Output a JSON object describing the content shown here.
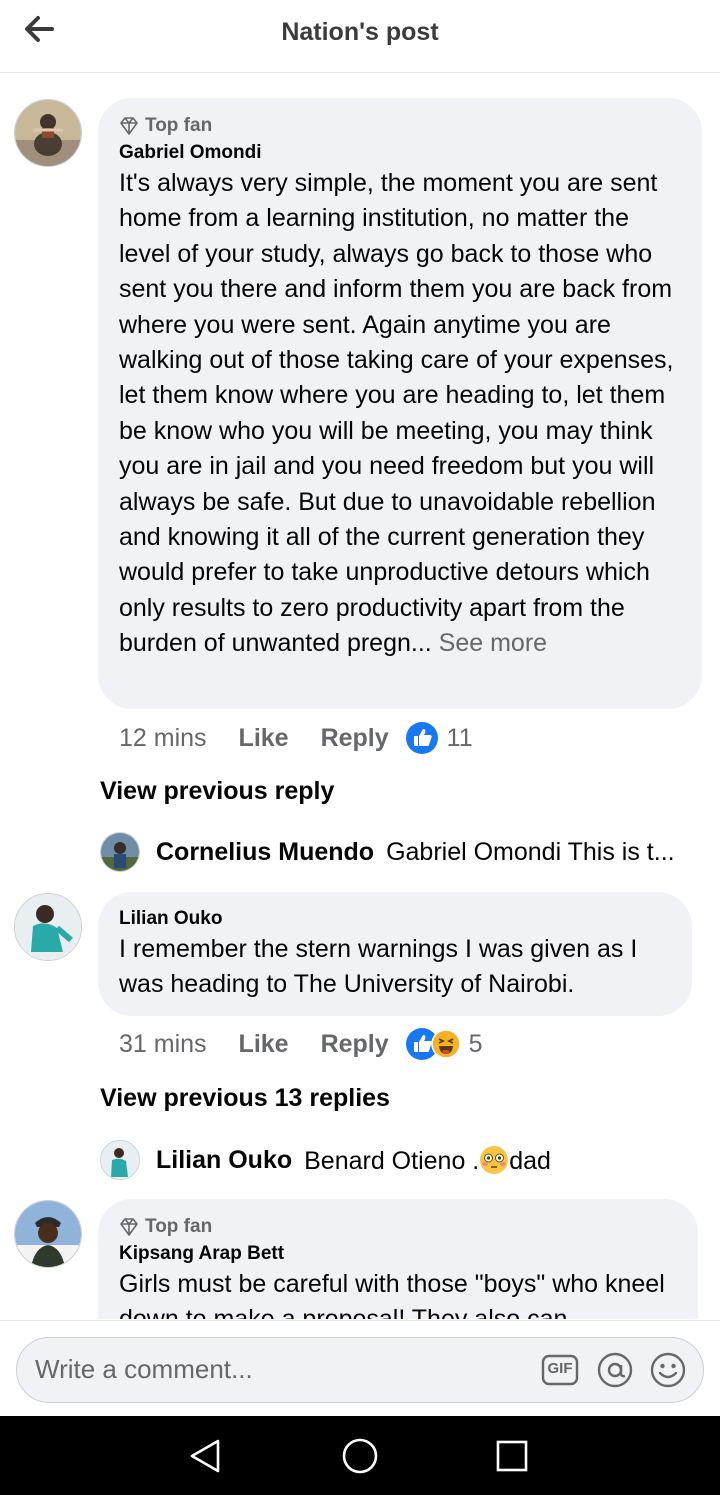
{
  "header": {
    "title": "Nation's post"
  },
  "comments": [
    {
      "badge": "Top fan",
      "name": "Gabriel Omondi",
      "text": "It's always very simple, the moment you are sent home from a learning institution, no matter the level of your study, always go back to those who sent you there and inform them you are back from where you were sent. Again anytime you are walking out of those taking care of your expenses, let them know where you are heading to, let them  be know who you will be meeting, you may think you are in jail and you need freedom but you will always be safe. But due to unavoidable rebellion and knowing it all of the current generation they would prefer to take unproductive detours which only results to zero productivity apart from the burden of unwanted pregn...",
      "see_more": " See more",
      "time": "12 mins",
      "like": "Like",
      "reply": "Reply",
      "reaction_count": "11",
      "view_previous": "View previous reply",
      "reply_preview": {
        "name": "Cornelius Muendo",
        "text": "Gabriel Omondi This is t..."
      }
    },
    {
      "name": "Lilian Ouko",
      "text": "I remember the stern warnings I was given as I was heading to The University of Nairobi.",
      "time": "31 mins",
      "like": "Like",
      "reply": "Reply",
      "reaction_count": "5",
      "view_previous": "View previous 13 replies",
      "reply_preview": {
        "name": "Lilian Ouko",
        "text_before": "Benard Otieno .",
        "text_after": "dad"
      }
    },
    {
      "badge": "Top fan",
      "name": "Kipsang Arap Bett",
      "text": "Girls must be careful with those \"boys\" who kneel down to make a proposal! They also can"
    }
  ],
  "composer": {
    "placeholder": "Write a comment...",
    "gif_label": "GIF"
  },
  "colors": {
    "like_blue": "#1877f2",
    "bubble_bg": "#f0f2f5",
    "secondary_text": "#65676b",
    "haha_yellow": "#f7b125"
  },
  "icons": [
    "back-arrow-icon",
    "diamond-icon",
    "like-reaction-icon",
    "haha-reaction-icon",
    "flushed-emoji-icon",
    "gif-icon",
    "at-icon",
    "smiley-icon",
    "nav-back-icon",
    "nav-home-icon",
    "nav-recents-icon"
  ]
}
